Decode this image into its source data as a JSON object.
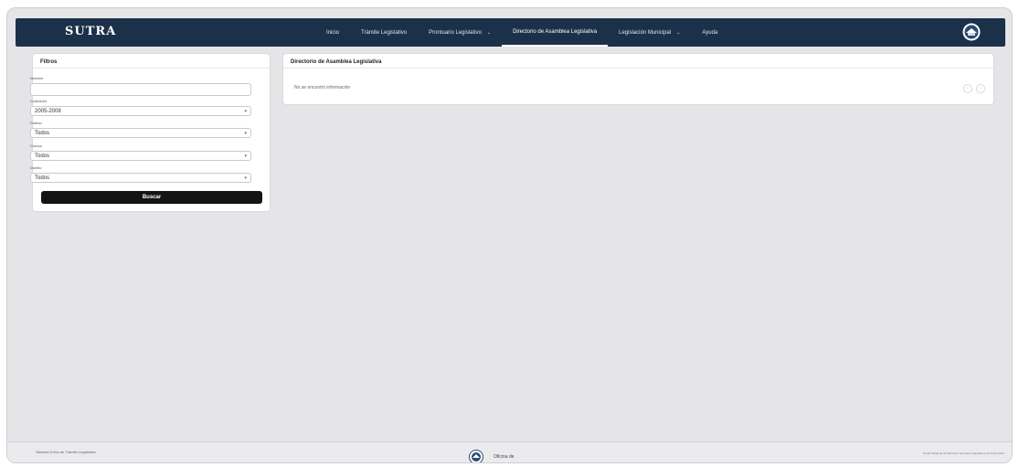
{
  "navbar": {
    "logo": "SUTRA",
    "items": [
      {
        "label": "Inicio",
        "chevron": ""
      },
      {
        "label": "Trámite Legislativo",
        "chevron": ""
      },
      {
        "label": "Prontuario Legislativo",
        "chevron": "⌄"
      },
      {
        "label": "Directorio de Asamblea Legislativa",
        "chevron": ""
      },
      {
        "label": "Legislación Municipal",
        "chevron": "⌄"
      },
      {
        "label": "Ayuda",
        "chevron": ""
      }
    ],
    "active_index": 3,
    "seal_icon": "seal-icon"
  },
  "filters": {
    "title": "Filtros",
    "fields": [
      {
        "label": "Nombre",
        "value": ""
      },
      {
        "label": "Cuatrienio",
        "value": "2005-2008"
      },
      {
        "label": "Partido",
        "value": "Todos"
      },
      {
        "label": "Cuerpo",
        "value": "Todos"
      },
      {
        "label": "Distrito",
        "value": "Todos"
      }
    ],
    "search_label": "Buscar"
  },
  "directory": {
    "title": "Directorio de Asamblea Legislativa",
    "empty_message": "No se encontró información",
    "prev_label": "‹",
    "next_label": "›"
  },
  "footer": {
    "left_title": "Sistema Único de Trámite Legislativo",
    "left_sub": "",
    "center_text": "Oficina de",
    "right_text": "Portal Oficial de la Oficina de Servicios Legislativos de Puerto Rico"
  },
  "colors": {
    "navbar": "#1b3149",
    "background": "#e5e5e8",
    "button": "#141414"
  }
}
